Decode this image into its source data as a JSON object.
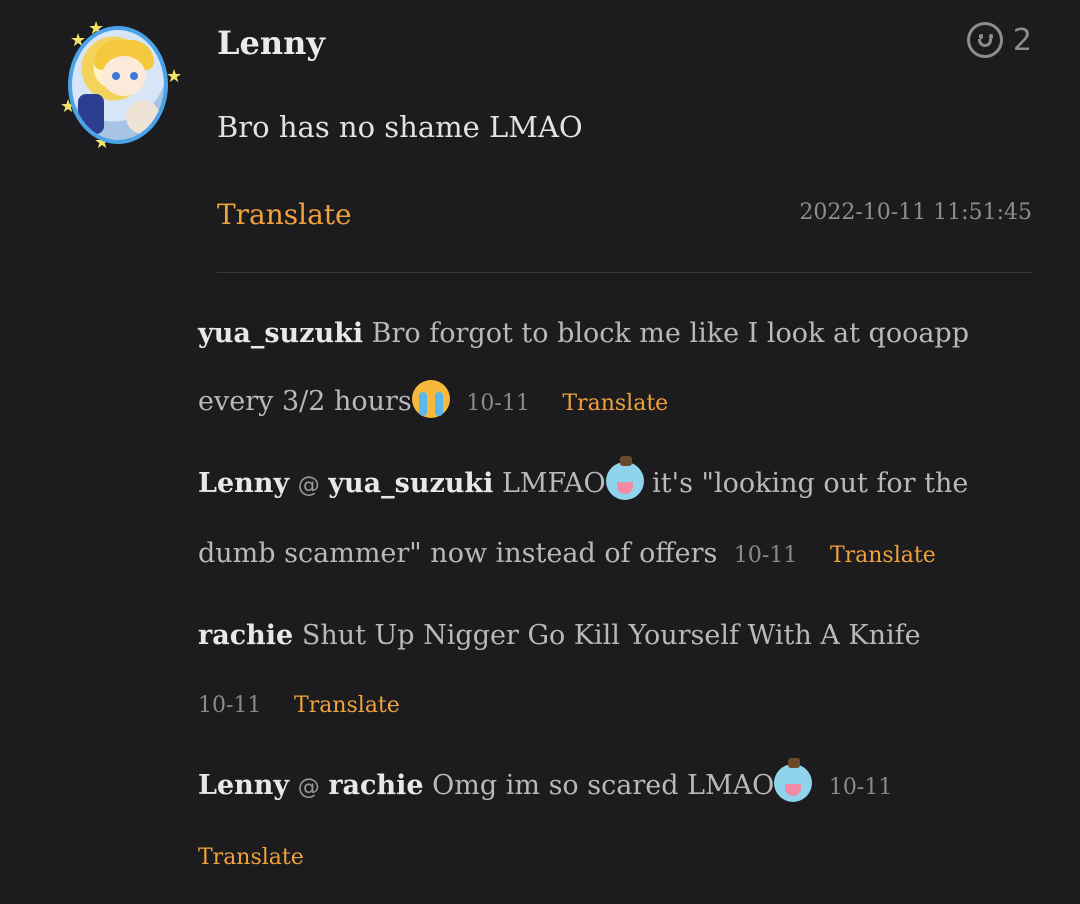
{
  "post": {
    "author": "Lenny",
    "reaction_count": "2",
    "body": "Bro has no shame LMAO",
    "translate_label": "Translate",
    "timestamp": "2022-10-11 11:51:45"
  },
  "replies": [
    {
      "user": "yua_suzuki",
      "text": "Bro forgot to block me like I look at qooapp every 3/2 hours",
      "emoji": "loudly-crying-face",
      "date": "10-11",
      "translate": "Translate"
    },
    {
      "user": "Lenny",
      "at_symbol": "@",
      "mention": "yua_suzuki",
      "text_before": "LMFAO",
      "emoji": "blob-sticker",
      "text_after": " it's \"looking out for the dumb scammer\" now instead of offers",
      "date": "10-11",
      "translate": "Translate"
    },
    {
      "user": "rachie",
      "text": "Shut Up Nigger Go Kill Yourself With A Knife",
      "date": "10-11",
      "translate": "Translate"
    },
    {
      "user": "Lenny",
      "at_symbol": "@",
      "mention": "rachie",
      "text": "Omg im so scared LMAO",
      "emoji": "blob-sticker",
      "date": "10-11",
      "translate": "Translate"
    }
  ]
}
